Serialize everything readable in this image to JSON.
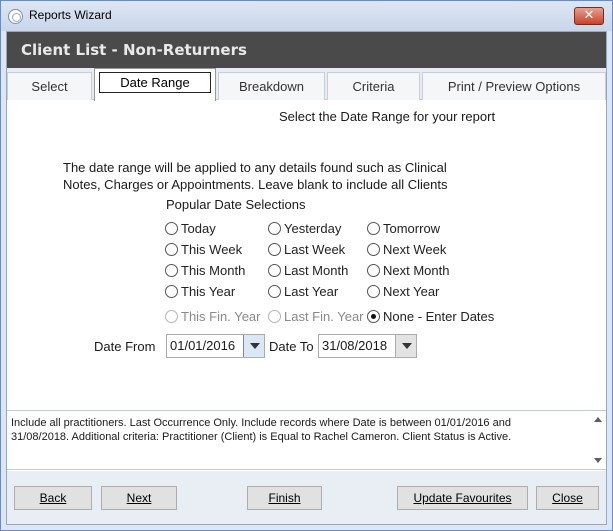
{
  "window": {
    "title": "Reports Wizard",
    "close_glyph": "✕"
  },
  "header": {
    "title": "Client List - Non-Returners"
  },
  "tabs": [
    {
      "label": "Select"
    },
    {
      "label": "Date Range"
    },
    {
      "label": "Breakdown"
    },
    {
      "label": "Criteria"
    },
    {
      "label": "Print / Preview Options"
    }
  ],
  "active_tab": "Date Range",
  "content": {
    "subtitle": "Select the Date Range for your report",
    "info_line1": "The date range will be applied to any details found such as Clinical",
    "info_line2": "Notes, Charges or Appointments.  Leave blank to include all Clients",
    "popular_label": "Popular Date Selections",
    "radios": {
      "today": "Today",
      "yesterday": "Yesterday",
      "tomorrow": "Tomorrow",
      "this_week": "This Week",
      "last_week": "Last Week",
      "next_week": "Next Week",
      "this_month": "This Month",
      "last_month": "Last Month",
      "next_month": "Next Month",
      "this_year": "This Year",
      "last_year": "Last Year",
      "next_year": "Next Year",
      "this_fin_year": "This Fin. Year",
      "last_fin_year": "Last Fin. Year",
      "none_enter_dates": "None - Enter Dates"
    },
    "selected_radio": "None - Enter Dates",
    "date_from_label": "Date From",
    "date_from_value": "01/01/2016",
    "date_to_label": "Date To",
    "date_to_value": "31/08/2018"
  },
  "summary": {
    "text_line1": "Include all practitioners. Last Occurrence Only. Include records where Date is between 01/01/2016 and",
    "text_line2": "31/08/2018. Additional criteria: Practitioner (Client) is Equal to Rachel Cameron. Client Status is Active."
  },
  "footer": {
    "back": "Back",
    "next": "Next",
    "finish": "Finish",
    "update_favourites": "Update Favourites",
    "close": "Close"
  },
  "colors": {
    "header_bg": "#4a4a4a",
    "titlebar": "#c9d6ea",
    "close_btn": "#c7432a"
  }
}
